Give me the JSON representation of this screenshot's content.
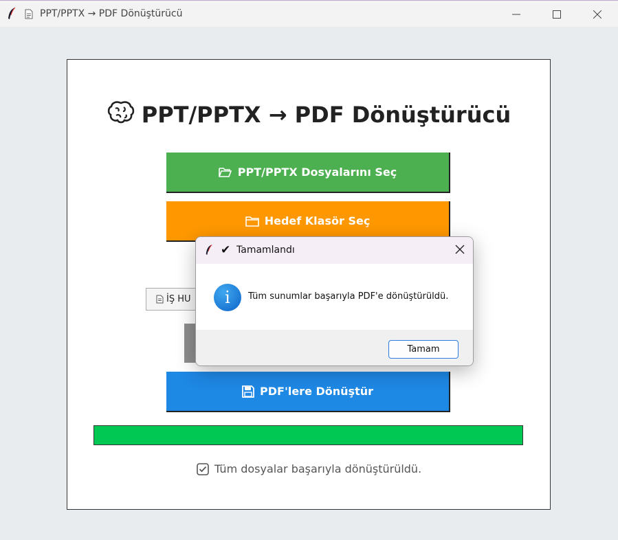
{
  "window": {
    "title": "PPT/PPTX → PDF Dönüştürücü"
  },
  "app": {
    "heading": "PPT/PPTX → PDF Dönüştürücü",
    "select_files_label": "PPT/PPTX Dosyalarını Seç",
    "select_target_label": "Hedef Klasör Seç",
    "file_chip_label": "İŞ HU",
    "convert_label": "PDF'lere Dönüştür",
    "progress": 1.0,
    "status_text": "Tüm dosyalar başarıyla dönüştürüldü."
  },
  "dialog": {
    "title": "Tamamlandı",
    "message": "Tüm sunumlar başarıyla PDF'e dönüştürüldü.",
    "ok_label": "Tamam"
  },
  "colors": {
    "select_button": "#4caf50",
    "target_button": "#ff9800",
    "convert_button": "#1e88e5",
    "progress_fill": "#00c853",
    "info_icon": "#1976d2"
  }
}
